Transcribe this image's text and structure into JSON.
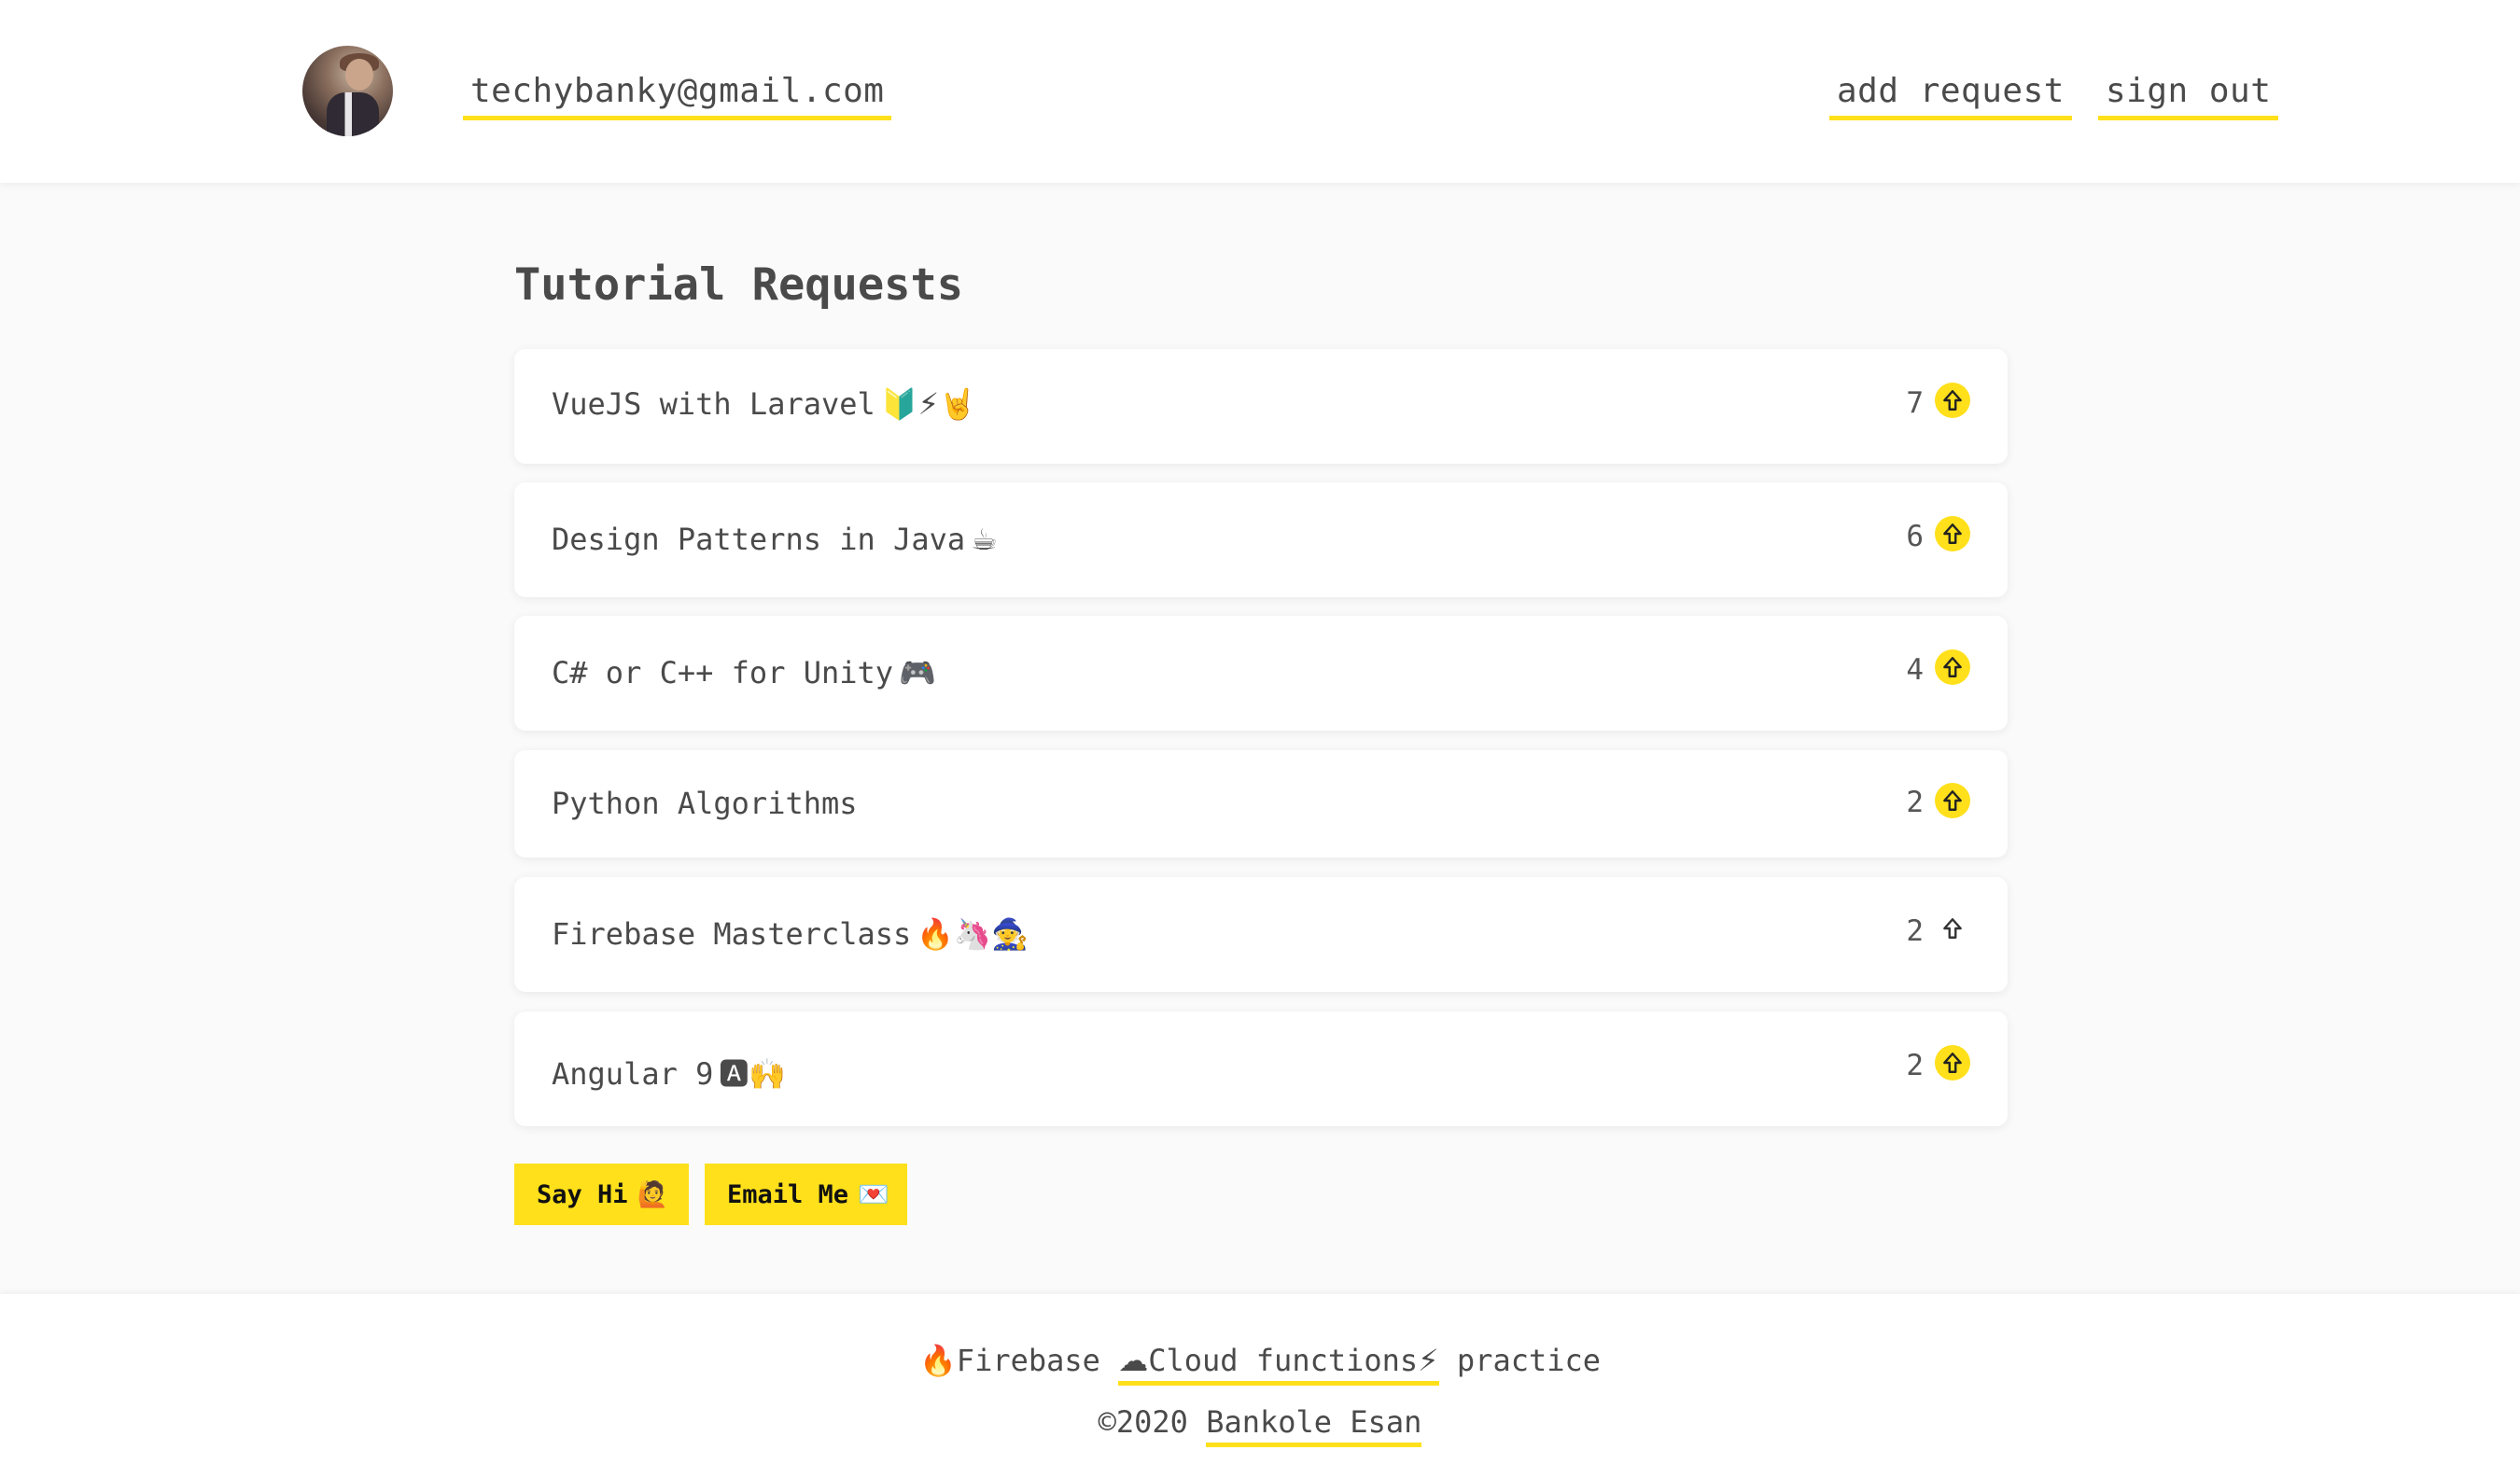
{
  "header": {
    "user_email": "techybanky@gmail.com",
    "add_request_label": "add request",
    "sign_out_label": "sign out"
  },
  "main": {
    "title": "Tutorial Requests",
    "requests": [
      {
        "title": "VueJS with Laravel",
        "emoji": "🔰⚡🤘",
        "votes": "7",
        "upvoted": true
      },
      {
        "title": "Design Patterns in Java",
        "emoji": "☕",
        "votes": "6",
        "upvoted": true
      },
      {
        "title": "C# or C++ for Unity",
        "emoji": "🎮",
        "votes": "4",
        "upvoted": true
      },
      {
        "title": "Python Algorithms",
        "emoji": "",
        "votes": "2",
        "upvoted": true
      },
      {
        "title": "Firebase Masterclass",
        "emoji": "🔥🦄🧙",
        "votes": "2",
        "upvoted": false
      },
      {
        "title": "Angular 9",
        "emoji": "🅰🙌",
        "votes": "2",
        "upvoted": true
      }
    ],
    "say_hi_label": "Say Hi",
    "say_hi_emoji": "🙋",
    "email_me_label": "Email Me",
    "email_me_emoji": "💌"
  },
  "footer": {
    "firebase_icon": "🔥",
    "firebase_label": "Firebase",
    "cloud_icon": "☁",
    "cloud_label": "Cloud functions",
    "bolt_icon": "⚡",
    "practice_label": "practice",
    "copyright": "©2020",
    "author": "Bankole Esan"
  },
  "colors": {
    "accent": "#ffe01b",
    "background": "#fafafa",
    "card": "#ffffff",
    "text": "#4a4a4a"
  }
}
